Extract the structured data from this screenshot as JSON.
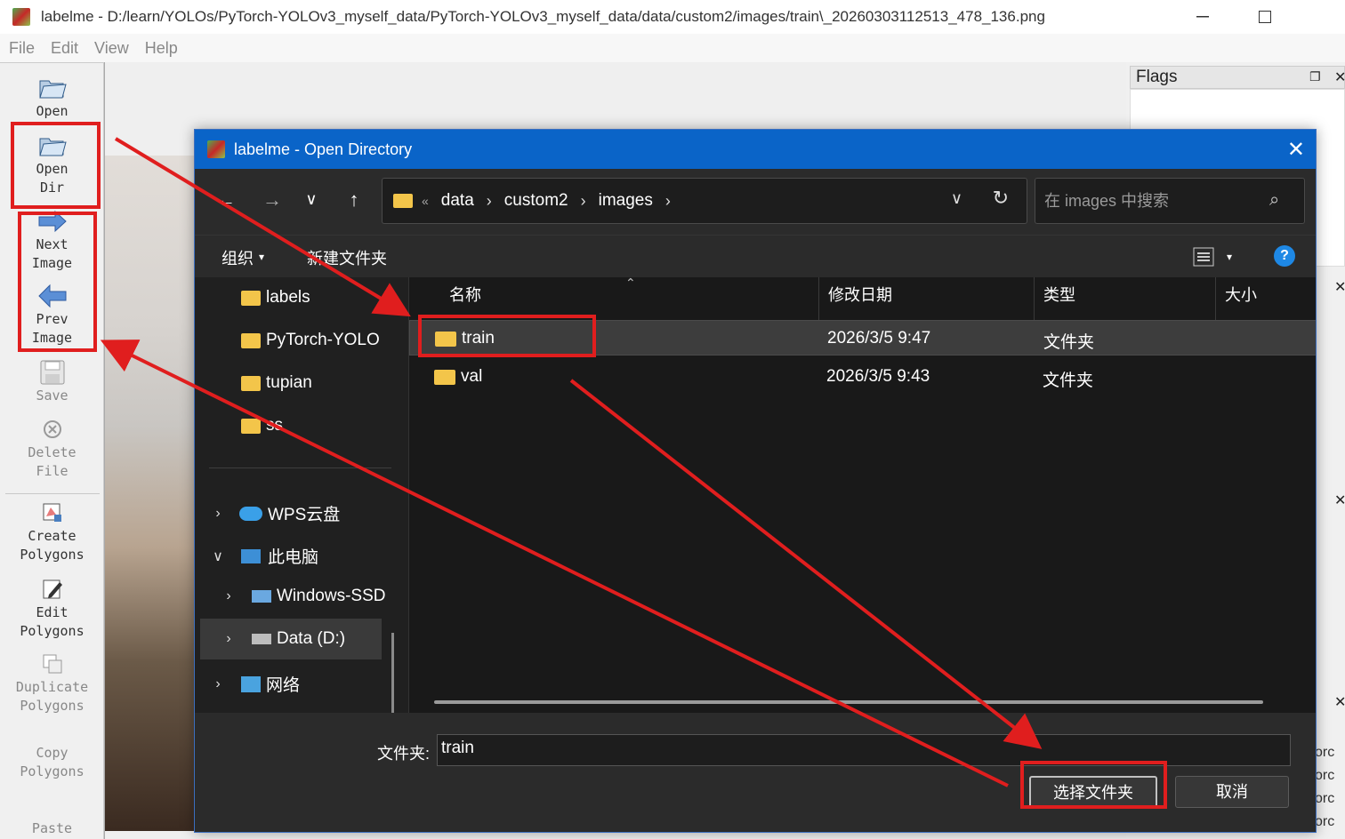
{
  "window": {
    "title": "labelme - D:/learn/YOLOs/PyTorch-YOLOv3_myself_data/PyTorch-YOLOv3_myself_data/data/custom2/images/train\\_20260303112513_478_136.png"
  },
  "menu": [
    "File",
    "Edit",
    "View",
    "Help"
  ],
  "toolbar": {
    "open": "Open",
    "open_dir_1": "Open",
    "open_dir_2": "Dir",
    "next_1": "Next",
    "next_2": "Image",
    "prev_1": "Prev",
    "prev_2": "Image",
    "save": "Save",
    "delete_1": "Delete",
    "delete_2": "File",
    "create_1": "Create",
    "create_2": "Polygons",
    "edit_1": "Edit",
    "edit_2": "Polygons",
    "dup_1": "Duplicate",
    "dup_2": "Polygons",
    "copy_1": "Copy",
    "copy_2": "Polygons",
    "paste": "Paste"
  },
  "right_panel": {
    "flags_title": "Flags",
    "partial_label": "orc"
  },
  "dialog": {
    "title": "labelme - Open Directory",
    "breadcrumb": [
      "data",
      "custom2",
      "images"
    ],
    "breadcrumb_prefix": "«",
    "search_placeholder": "在 images 中搜索",
    "organize": "组织",
    "new_folder": "新建文件夹",
    "nav_items": {
      "labels": "labels",
      "pytorch": "PyTorch-YOLO",
      "tupian": "tupian",
      "ss": "ss",
      "wps": "WPS云盘",
      "pc": "此电脑",
      "windows": "Windows-SSD",
      "data_d": "Data (D:)",
      "network": "网络"
    },
    "columns": {
      "name": "名称",
      "date": "修改日期",
      "type": "类型",
      "size": "大小"
    },
    "rows": [
      {
        "name": "train",
        "date": "2026/3/5 9:47",
        "type": "文件夹"
      },
      {
        "name": "val",
        "date": "2026/3/5 9:43",
        "type": "文件夹"
      }
    ],
    "folder_label": "文件夹:",
    "folder_value": "train",
    "select_button": "选择文件夹",
    "cancel_button": "取消"
  },
  "annotation_color": "#e01e1e"
}
